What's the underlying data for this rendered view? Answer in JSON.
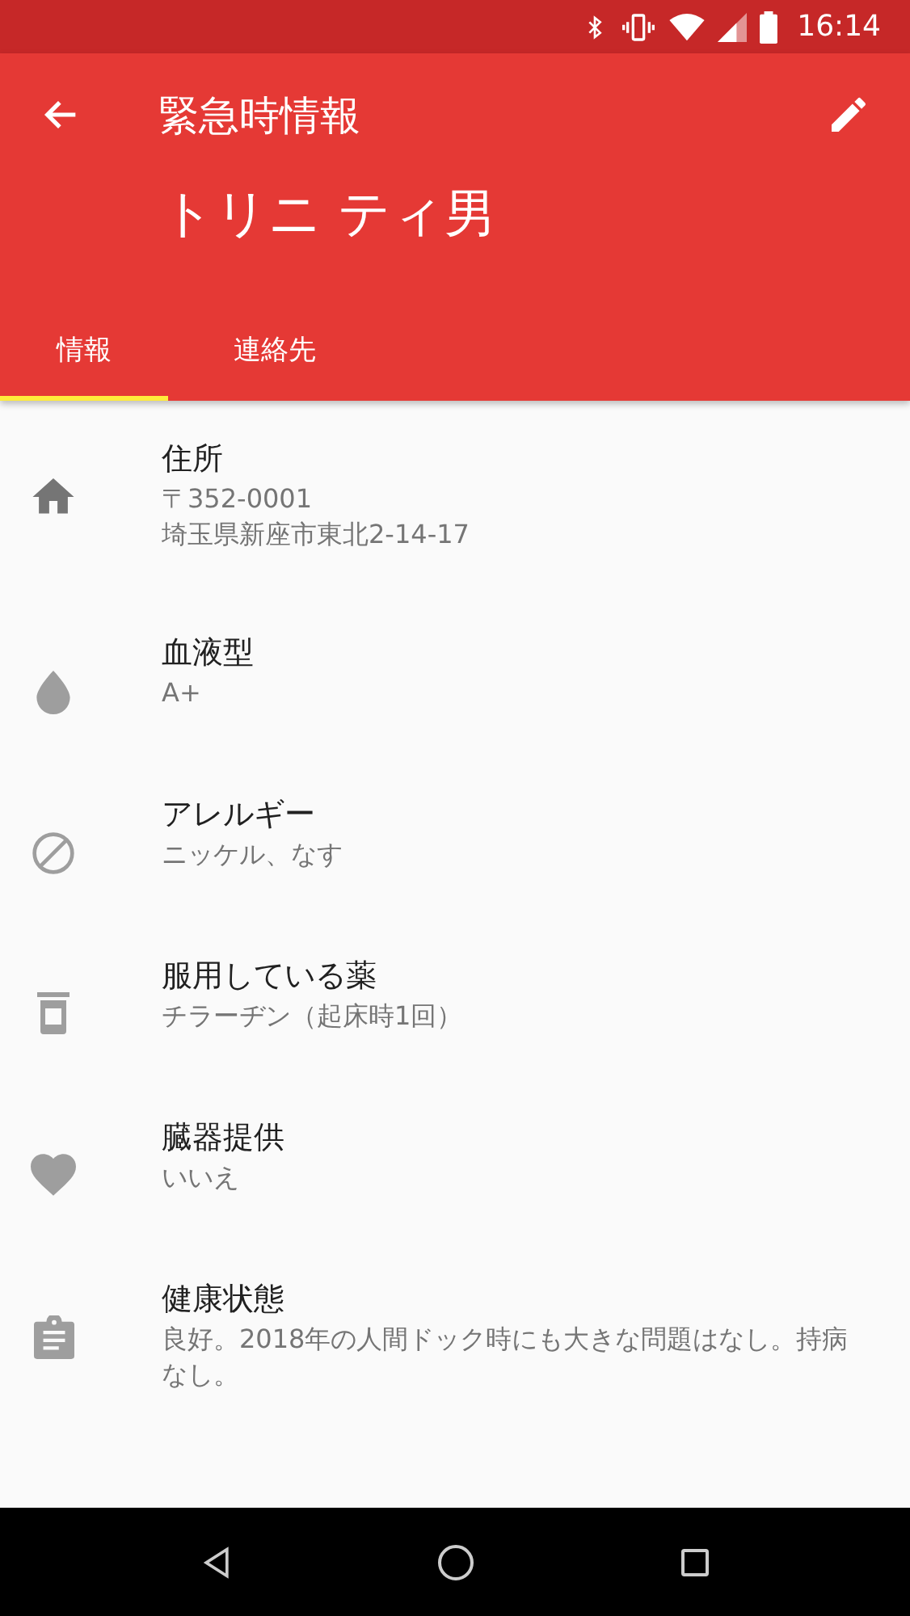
{
  "status_bar": {
    "time": "16:14"
  },
  "app_bar": {
    "title": "緊急時情報",
    "name": "トリニ ティ男"
  },
  "tabs": [
    {
      "label": "情報",
      "selected": true
    },
    {
      "label": "連絡先",
      "selected": false
    }
  ],
  "items": [
    {
      "kind": "home",
      "title": "住所",
      "lines": [
        "〒352-0001",
        "埼玉県新座市東北2-14-17"
      ]
    },
    {
      "kind": "drop",
      "title": "血液型",
      "lines": [
        "A+"
      ]
    },
    {
      "kind": "block",
      "title": "アレルギー",
      "lines": [
        "ニッケル、なす"
      ]
    },
    {
      "kind": "medicine",
      "title": "服用している薬",
      "lines": [
        "チラーヂン（起床時1回）"
      ]
    },
    {
      "kind": "heart",
      "title": "臓器提供",
      "lines": [
        "いいえ"
      ]
    },
    {
      "kind": "clipboard",
      "title": "健康状態",
      "lines": [
        "良好。2018年の人間ドック時にも大きな問題はなし。持病なし。"
      ]
    }
  ]
}
